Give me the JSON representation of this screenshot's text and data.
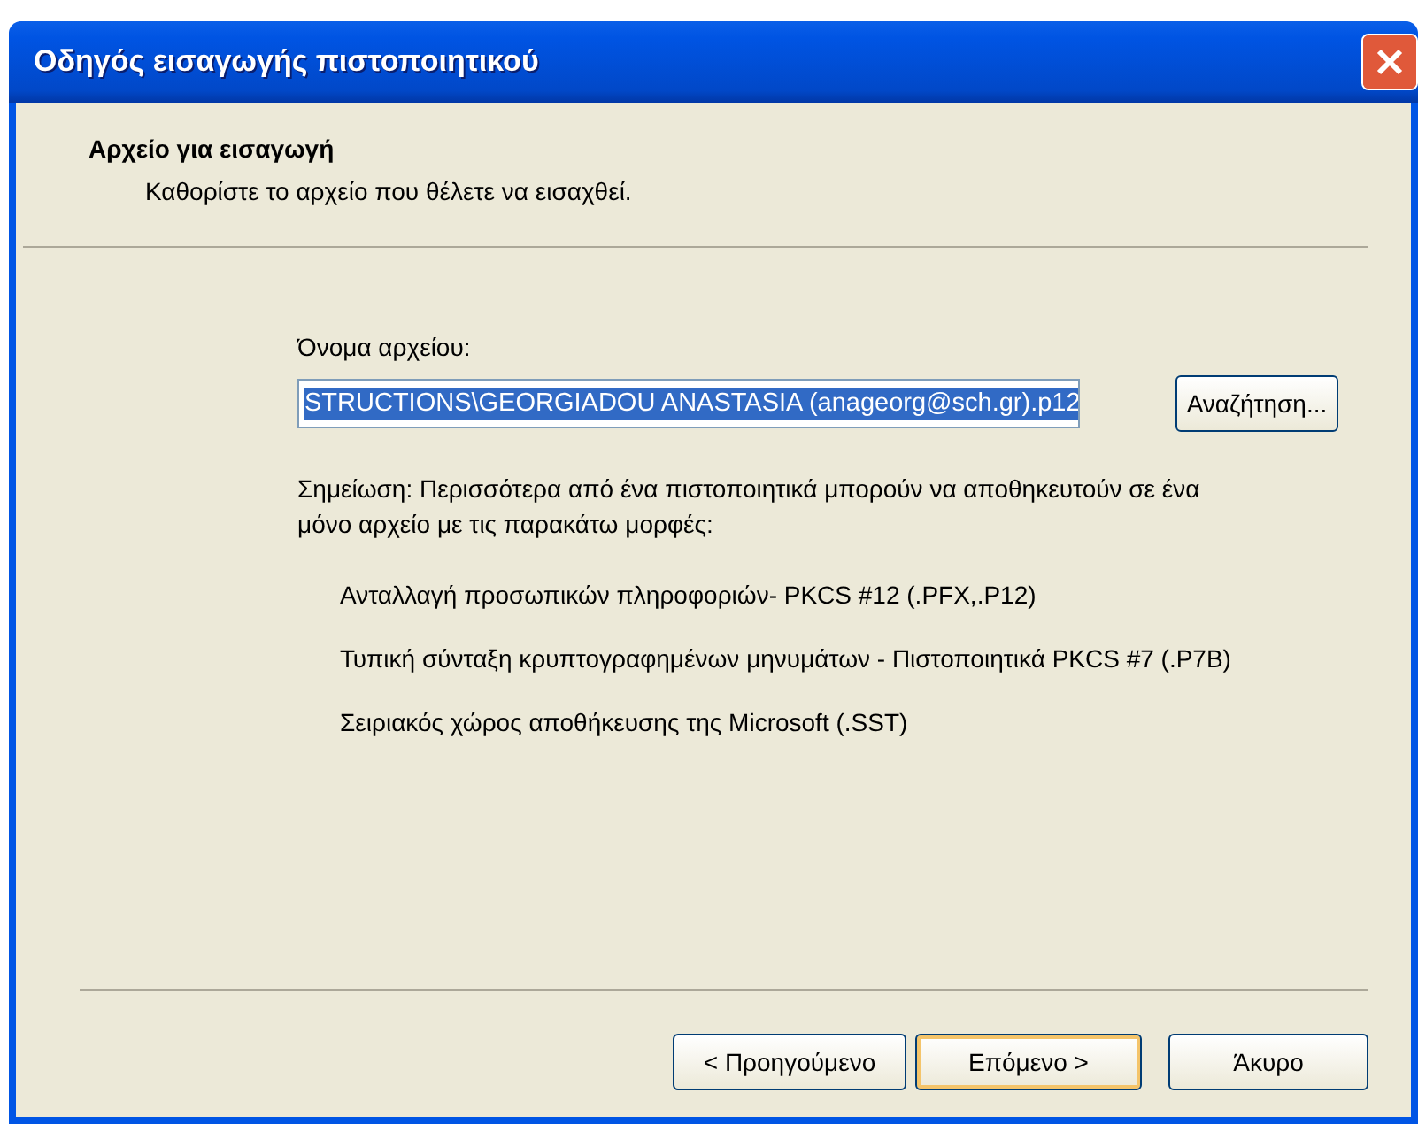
{
  "window": {
    "title": "Οδηγός εισαγωγής πιστοποιητικού"
  },
  "header": {
    "title": "Αρχείο για εισαγωγή",
    "subtitle": "Καθορίστε το αρχείο που θέλετε να εισαχθεί."
  },
  "file_field": {
    "label": "Όνομα αρχείου:",
    "value": "STRUCTIONS\\GEORGIADOU ANASTASIA (anageorg@sch.gr).p12",
    "text_selected": true
  },
  "browse_button": {
    "label": "Αναζήτηση..."
  },
  "note": "Σημείωση:  Περισσότερα από ένα πιστοποιητικά μπορούν να αποθηκευτούν σε ένα μόνο αρχείο με τις παρακάτω μορφές:",
  "formats": [
    "Ανταλλαγή προσωπικών πληροφοριών- PKCS #12 (.PFX,.P12)",
    "Τυπική σύνταξη κρυπτογραφημένων μηνυμάτων - Πιστοποιητικά PKCS #7 (.P7B)",
    "Σειριακός χώρος αποθήκευσης της Microsoft (.SST)"
  ],
  "buttons": [
    {
      "label": "< Προηγούμενο",
      "kind": "normal"
    },
    {
      "label": "Επόμενο >",
      "kind": "default"
    },
    {
      "label": "Άκυρο",
      "kind": "normal"
    }
  ]
}
